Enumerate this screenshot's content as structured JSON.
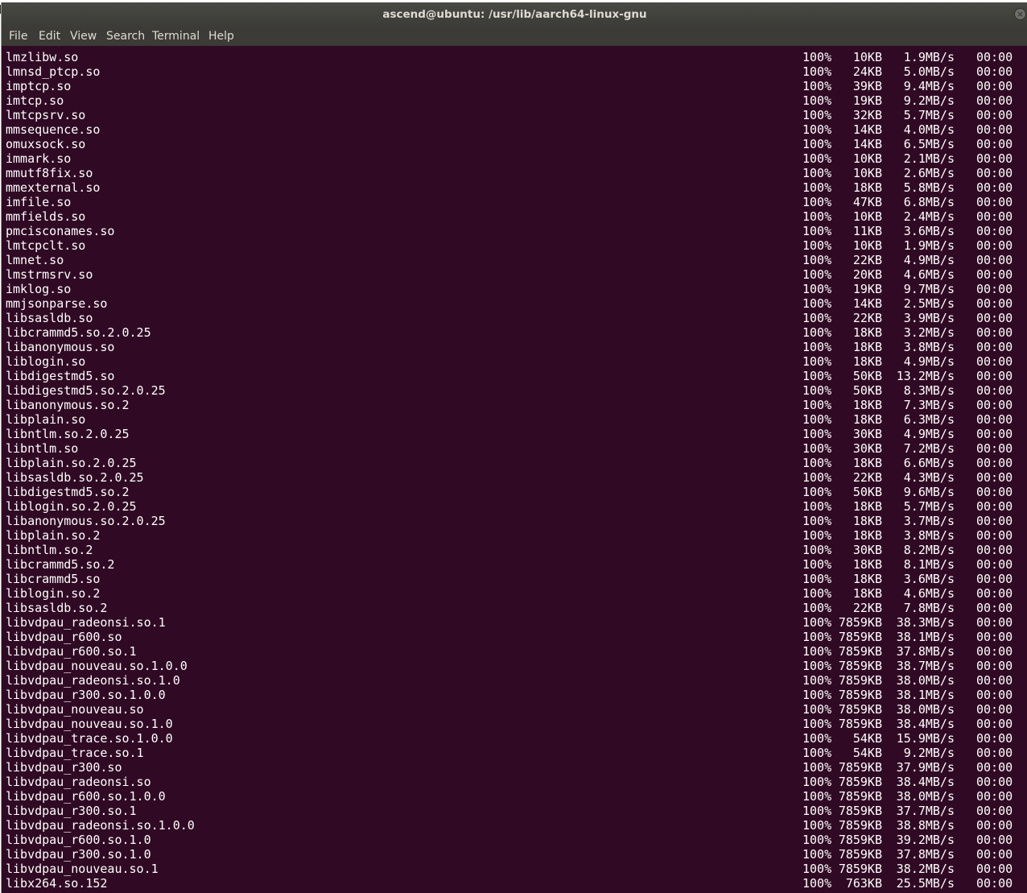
{
  "window": {
    "title": "ascend@ubuntu: /usr/lib/aarch64-linux-gnu",
    "colors": {
      "terminal_bg": "#300a24",
      "titlebar_bg": "#3c3b37",
      "text": "#ffffff"
    }
  },
  "menu": [
    "File",
    "Edit",
    "View",
    "Search",
    "Terminal",
    "Help"
  ],
  "icons": {
    "close": "close-icon"
  },
  "rows": [
    {
      "name": "lmzlibw.so",
      "pct": "100%",
      "size": "10KB",
      "rate": "1.9MB/s",
      "time": "00:00"
    },
    {
      "name": "lmnsd_ptcp.so",
      "pct": "100%",
      "size": "24KB",
      "rate": "5.0MB/s",
      "time": "00:00"
    },
    {
      "name": "imptcp.so",
      "pct": "100%",
      "size": "39KB",
      "rate": "9.4MB/s",
      "time": "00:00"
    },
    {
      "name": "imtcp.so",
      "pct": "100%",
      "size": "19KB",
      "rate": "9.2MB/s",
      "time": "00:00"
    },
    {
      "name": "lmtcpsrv.so",
      "pct": "100%",
      "size": "32KB",
      "rate": "5.7MB/s",
      "time": "00:00"
    },
    {
      "name": "mmsequence.so",
      "pct": "100%",
      "size": "14KB",
      "rate": "4.0MB/s",
      "time": "00:00"
    },
    {
      "name": "omuxsock.so",
      "pct": "100%",
      "size": "14KB",
      "rate": "6.5MB/s",
      "time": "00:00"
    },
    {
      "name": "immark.so",
      "pct": "100%",
      "size": "10KB",
      "rate": "2.1MB/s",
      "time": "00:00"
    },
    {
      "name": "mmutf8fix.so",
      "pct": "100%",
      "size": "10KB",
      "rate": "2.6MB/s",
      "time": "00:00"
    },
    {
      "name": "mmexternal.so",
      "pct": "100%",
      "size": "18KB",
      "rate": "5.8MB/s",
      "time": "00:00"
    },
    {
      "name": "imfile.so",
      "pct": "100%",
      "size": "47KB",
      "rate": "6.8MB/s",
      "time": "00:00"
    },
    {
      "name": "mmfields.so",
      "pct": "100%",
      "size": "10KB",
      "rate": "2.4MB/s",
      "time": "00:00"
    },
    {
      "name": "pmcisconames.so",
      "pct": "100%",
      "size": "11KB",
      "rate": "3.6MB/s",
      "time": "00:00"
    },
    {
      "name": "lmtcpclt.so",
      "pct": "100%",
      "size": "10KB",
      "rate": "1.9MB/s",
      "time": "00:00"
    },
    {
      "name": "lmnet.so",
      "pct": "100%",
      "size": "22KB",
      "rate": "4.9MB/s",
      "time": "00:00"
    },
    {
      "name": "lmstrmsrv.so",
      "pct": "100%",
      "size": "20KB",
      "rate": "4.6MB/s",
      "time": "00:00"
    },
    {
      "name": "imklog.so",
      "pct": "100%",
      "size": "19KB",
      "rate": "9.7MB/s",
      "time": "00:00"
    },
    {
      "name": "mmjsonparse.so",
      "pct": "100%",
      "size": "14KB",
      "rate": "2.5MB/s",
      "time": "00:00"
    },
    {
      "name": "libsasldb.so",
      "pct": "100%",
      "size": "22KB",
      "rate": "3.9MB/s",
      "time": "00:00"
    },
    {
      "name": "libcrammd5.so.2.0.25",
      "pct": "100%",
      "size": "18KB",
      "rate": "3.2MB/s",
      "time": "00:00"
    },
    {
      "name": "libanonymous.so",
      "pct": "100%",
      "size": "18KB",
      "rate": "3.8MB/s",
      "time": "00:00"
    },
    {
      "name": "liblogin.so",
      "pct": "100%",
      "size": "18KB",
      "rate": "4.9MB/s",
      "time": "00:00"
    },
    {
      "name": "libdigestmd5.so",
      "pct": "100%",
      "size": "50KB",
      "rate": "13.2MB/s",
      "time": "00:00"
    },
    {
      "name": "libdigestmd5.so.2.0.25",
      "pct": "100%",
      "size": "50KB",
      "rate": "8.3MB/s",
      "time": "00:00"
    },
    {
      "name": "libanonymous.so.2",
      "pct": "100%",
      "size": "18KB",
      "rate": "7.3MB/s",
      "time": "00:00"
    },
    {
      "name": "libplain.so",
      "pct": "100%",
      "size": "18KB",
      "rate": "6.3MB/s",
      "time": "00:00"
    },
    {
      "name": "libntlm.so.2.0.25",
      "pct": "100%",
      "size": "30KB",
      "rate": "4.9MB/s",
      "time": "00:00"
    },
    {
      "name": "libntlm.so",
      "pct": "100%",
      "size": "30KB",
      "rate": "7.2MB/s",
      "time": "00:00"
    },
    {
      "name": "libplain.so.2.0.25",
      "pct": "100%",
      "size": "18KB",
      "rate": "6.6MB/s",
      "time": "00:00"
    },
    {
      "name": "libsasldb.so.2.0.25",
      "pct": "100%",
      "size": "22KB",
      "rate": "4.3MB/s",
      "time": "00:00"
    },
    {
      "name": "libdigestmd5.so.2",
      "pct": "100%",
      "size": "50KB",
      "rate": "9.6MB/s",
      "time": "00:00"
    },
    {
      "name": "liblogin.so.2.0.25",
      "pct": "100%",
      "size": "18KB",
      "rate": "5.7MB/s",
      "time": "00:00"
    },
    {
      "name": "libanonymous.so.2.0.25",
      "pct": "100%",
      "size": "18KB",
      "rate": "3.7MB/s",
      "time": "00:00"
    },
    {
      "name": "libplain.so.2",
      "pct": "100%",
      "size": "18KB",
      "rate": "3.8MB/s",
      "time": "00:00"
    },
    {
      "name": "libntlm.so.2",
      "pct": "100%",
      "size": "30KB",
      "rate": "8.2MB/s",
      "time": "00:00"
    },
    {
      "name": "libcrammd5.so.2",
      "pct": "100%",
      "size": "18KB",
      "rate": "8.1MB/s",
      "time": "00:00"
    },
    {
      "name": "libcrammd5.so",
      "pct": "100%",
      "size": "18KB",
      "rate": "3.6MB/s",
      "time": "00:00"
    },
    {
      "name": "liblogin.so.2",
      "pct": "100%",
      "size": "18KB",
      "rate": "4.6MB/s",
      "time": "00:00"
    },
    {
      "name": "libsasldb.so.2",
      "pct": "100%",
      "size": "22KB",
      "rate": "7.8MB/s",
      "time": "00:00"
    },
    {
      "name": "libvdpau_radeonsi.so.1",
      "pct": "100%",
      "size": "7859KB",
      "rate": "38.3MB/s",
      "time": "00:00"
    },
    {
      "name": "libvdpau_r600.so",
      "pct": "100%",
      "size": "7859KB",
      "rate": "38.1MB/s",
      "time": "00:00"
    },
    {
      "name": "libvdpau_r600.so.1",
      "pct": "100%",
      "size": "7859KB",
      "rate": "37.8MB/s",
      "time": "00:00"
    },
    {
      "name": "libvdpau_nouveau.so.1.0.0",
      "pct": "100%",
      "size": "7859KB",
      "rate": "38.7MB/s",
      "time": "00:00"
    },
    {
      "name": "libvdpau_radeonsi.so.1.0",
      "pct": "100%",
      "size": "7859KB",
      "rate": "38.0MB/s",
      "time": "00:00"
    },
    {
      "name": "libvdpau_r300.so.1.0.0",
      "pct": "100%",
      "size": "7859KB",
      "rate": "38.1MB/s",
      "time": "00:00"
    },
    {
      "name": "libvdpau_nouveau.so",
      "pct": "100%",
      "size": "7859KB",
      "rate": "38.0MB/s",
      "time": "00:00"
    },
    {
      "name": "libvdpau_nouveau.so.1.0",
      "pct": "100%",
      "size": "7859KB",
      "rate": "38.4MB/s",
      "time": "00:00"
    },
    {
      "name": "libvdpau_trace.so.1.0.0",
      "pct": "100%",
      "size": "54KB",
      "rate": "15.9MB/s",
      "time": "00:00"
    },
    {
      "name": "libvdpau_trace.so.1",
      "pct": "100%",
      "size": "54KB",
      "rate": "9.2MB/s",
      "time": "00:00"
    },
    {
      "name": "libvdpau_r300.so",
      "pct": "100%",
      "size": "7859KB",
      "rate": "37.9MB/s",
      "time": "00:00"
    },
    {
      "name": "libvdpau_radeonsi.so",
      "pct": "100%",
      "size": "7859KB",
      "rate": "38.4MB/s",
      "time": "00:00"
    },
    {
      "name": "libvdpau_r600.so.1.0.0",
      "pct": "100%",
      "size": "7859KB",
      "rate": "38.0MB/s",
      "time": "00:00"
    },
    {
      "name": "libvdpau_r300.so.1",
      "pct": "100%",
      "size": "7859KB",
      "rate": "37.7MB/s",
      "time": "00:00"
    },
    {
      "name": "libvdpau_radeonsi.so.1.0.0",
      "pct": "100%",
      "size": "7859KB",
      "rate": "38.8MB/s",
      "time": "00:00"
    },
    {
      "name": "libvdpau_r600.so.1.0",
      "pct": "100%",
      "size": "7859KB",
      "rate": "39.2MB/s",
      "time": "00:00"
    },
    {
      "name": "libvdpau_r300.so.1.0",
      "pct": "100%",
      "size": "7859KB",
      "rate": "37.8MB/s",
      "time": "00:00"
    },
    {
      "name": "libvdpau_nouveau.so.1",
      "pct": "100%",
      "size": "7859KB",
      "rate": "38.2MB/s",
      "time": "00:00"
    },
    {
      "name": "libx264.so.152",
      "pct": "100%",
      "size": "763KB",
      "rate": "25.5MB/s",
      "time": "00:00"
    }
  ]
}
